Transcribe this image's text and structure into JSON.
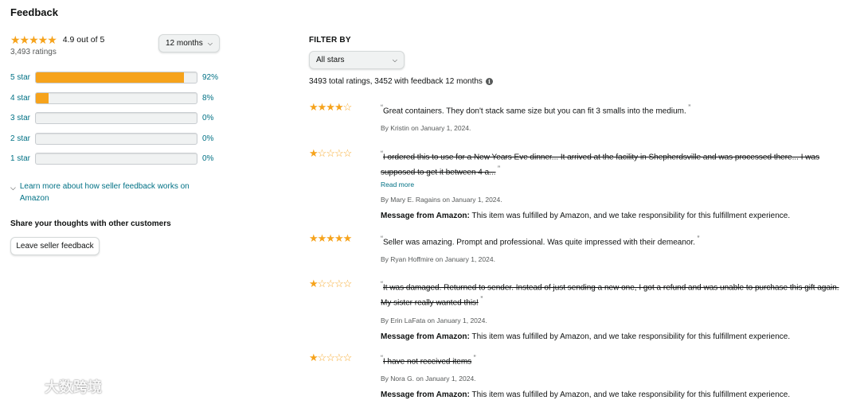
{
  "header": {
    "title": "Feedback"
  },
  "summary": {
    "rating_text": "4.9 out of  5",
    "total_ratings": "3,493 ratings",
    "period": "12 months",
    "rating_value": 4.9
  },
  "histogram": [
    {
      "label": "5 star",
      "pct_text": "92%",
      "pct": 92
    },
    {
      "label": "4 star",
      "pct_text": "8%",
      "pct": 8
    },
    {
      "label": "3 star",
      "pct_text": "0%",
      "pct": 0
    },
    {
      "label": "2 star",
      "pct_text": "0%",
      "pct": 0
    },
    {
      "label": "1 star",
      "pct_text": "0%",
      "pct": 0
    }
  ],
  "learn_more": "Learn more about how seller feedback works on Amazon",
  "share": {
    "heading": "Share your thoughts with other customers",
    "button": "Leave seller feedback"
  },
  "filter": {
    "label": "FILTER BY",
    "selected": "All stars",
    "totals": "3493 total ratings, 3452 with feedback 12 months"
  },
  "reviews": [
    {
      "stars": 4,
      "text": "Great containers. They don't stack same size but you can fit 3 smalls into the medium.",
      "struck": false,
      "byline": "By Kristin on January 1, 2024.",
      "read_more": "",
      "message_label": "",
      "message_text": ""
    },
    {
      "stars": 1,
      "text": "I ordered this to use for a New Years Eve dinner... It arrived at the facility in Shepherdsville and was processed there... I was supposed to get it between 4 a...",
      "struck": true,
      "byline": "By Mary E. Ragains on January 1, 2024.",
      "read_more": "Read more",
      "message_label": "Message from Amazon:",
      "message_text": "This item was fulfilled by Amazon, and we take responsibility for this fulfillment experience."
    },
    {
      "stars": 5,
      "text": "Seller was amazing. Prompt and professional. Was quite impressed with their demeanor.",
      "struck": false,
      "byline": "By Ryan Hoffmire on January 1, 2024.",
      "read_more": "",
      "message_label": "",
      "message_text": ""
    },
    {
      "stars": 1,
      "text": "It was damaged. Returned to sender. Instead of just sending a new one, I got a refund and was unable to purchase this gift again. My sister really wanted this!",
      "struck": true,
      "byline": "By Erin LaFata on January 1, 2024.",
      "read_more": "",
      "message_label": "Message from Amazon:",
      "message_text": "This item was fulfilled by Amazon, and we take responsibility for this fulfillment experience."
    },
    {
      "stars": 1,
      "text": "I have not received items",
      "struck": true,
      "byline": "By Nora G. on January 1, 2024.",
      "read_more": "",
      "message_label": "Message from Amazon:",
      "message_text": "This item was fulfilled by Amazon, and we take responsibility for this fulfillment experience."
    }
  ],
  "watermark": {
    "text": "大数跨境"
  },
  "colors": {
    "star": "#f6a31c",
    "link": "#007185",
    "muted": "#565959"
  }
}
